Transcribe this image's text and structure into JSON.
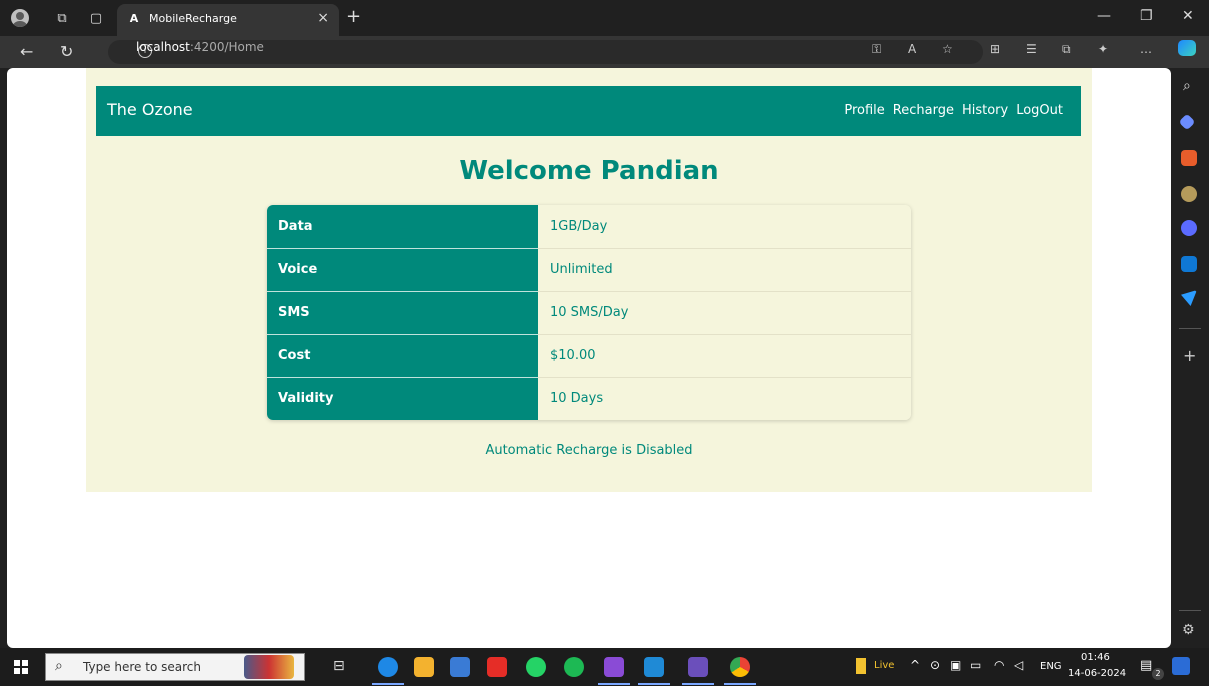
{
  "browser": {
    "tab_title": "MobileRecharge",
    "tab_favicon": "A",
    "url_host": "localhost",
    "url_path": ":4200/Home"
  },
  "app": {
    "brand": "The Ozone",
    "nav": [
      "Profile",
      "Recharge",
      "History",
      "LogOut"
    ],
    "welcome": "Welcome Pandian",
    "plan": [
      {
        "label": "Data",
        "value": "1GB/Day"
      },
      {
        "label": "Voice",
        "value": "Unlimited"
      },
      {
        "label": "SMS",
        "value": "10 SMS/Day"
      },
      {
        "label": "Cost",
        "value": "$10.00"
      },
      {
        "label": "Validity",
        "value": "10 Days"
      }
    ],
    "auto_recharge_status": "Automatic Recharge is Disabled"
  },
  "taskbar": {
    "search_placeholder": "Type here to search",
    "live_label": "Live",
    "language": "ENG",
    "time": "01:46",
    "date": "14-06-2024",
    "notification_count": "2"
  },
  "colors": {
    "primary": "#00897b",
    "panel_bg": "#f5f5dc"
  }
}
